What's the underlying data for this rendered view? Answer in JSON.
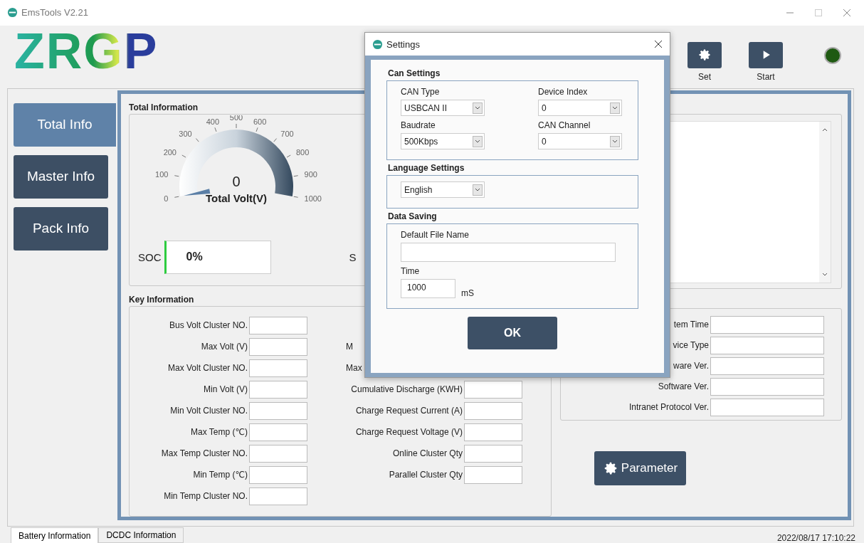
{
  "window": {
    "title": "EmsTools V2.21"
  },
  "logo": {
    "text": "ZRGP"
  },
  "toolbar": [
    {
      "label": "Set",
      "kind": "gear"
    },
    {
      "label": "Start",
      "kind": "play"
    }
  ],
  "status_light": {
    "lit": false
  },
  "nav": [
    {
      "label": "Total Info",
      "selected": true
    },
    {
      "label": "Master Info",
      "selected": false
    },
    {
      "label": "Pack Info",
      "selected": false
    }
  ],
  "total_information": {
    "title": "Total Information",
    "gauge": {
      "ticks": [
        "400",
        "500",
        "600",
        "300",
        "700",
        "200",
        "800",
        "100",
        "900",
        "0",
        "1000"
      ],
      "value": "0",
      "label": "Total Volt(V)",
      "level": 0
    },
    "soc": {
      "label": "SOC",
      "value": "0%"
    },
    "cut_label": "S"
  },
  "key_information": {
    "title": "Key Information",
    "left": [
      {
        "label": "Bus Volt Cluster NO.",
        "cut": false
      },
      {
        "label": "Max Volt (V)",
        "cut": false
      },
      {
        "label": "Max Volt Cluster NO.",
        "cut": false
      },
      {
        "label": "Min Volt (V)",
        "cut": false
      },
      {
        "label": "Min Volt Cluster NO.",
        "cut": false
      },
      {
        "label": "Max Temp (℃)",
        "cut": false
      },
      {
        "label": "Max Temp Cluster NO.",
        "cut": false
      },
      {
        "label": "Min Temp (℃)",
        "cut": false
      },
      {
        "label": "Min Temp Cluster NO.",
        "cut": false
      }
    ],
    "right": [
      {
        "label": "M",
        "cut": true
      },
      {
        "label": "Max",
        "cut": true
      },
      {
        "label": "Cumulative Discharge (KWH)",
        "cut": false
      },
      {
        "label": "Charge Request Current (A)",
        "cut": false
      },
      {
        "label": "Charge Request Voltage (V)",
        "cut": false
      },
      {
        "label": "Online Cluster Qty",
        "cut": false
      },
      {
        "label": "Parallel Cluster Qty",
        "cut": false
      }
    ]
  },
  "device_information": {
    "rows": [
      "tem Time",
      "vice Type",
      "ware Ver.",
      "Software Ver.",
      "Intranet Protocol Ver."
    ]
  },
  "parameter_button": {
    "label": "Parameter"
  },
  "bottom_tabs": [
    {
      "label": "Battery Information",
      "selected": true
    },
    {
      "label": "DCDC Information",
      "selected": false
    }
  ],
  "timestamp": "2022/08/17 17:10:22",
  "dialog": {
    "title": "Settings",
    "sections": [
      {
        "title": "Can Settings",
        "fields": [
          {
            "label": "CAN Type",
            "kind": "select",
            "value": "USBCAN II"
          },
          {
            "label": "Device Index",
            "kind": "select",
            "value": "0"
          },
          {
            "label": "Baudrate",
            "kind": "select",
            "value": "500Kbps"
          },
          {
            "label": "CAN Channel",
            "kind": "select",
            "value": "0"
          }
        ]
      },
      {
        "title": "Language Settings",
        "fields": [
          {
            "kind": "select",
            "value": "English"
          }
        ]
      },
      {
        "title": "Data Saving",
        "fields": [
          {
            "label": "Default File Name",
            "kind": "text"
          },
          {
            "label": "Time",
            "kind": "number",
            "value": "1000",
            "unit": "mS"
          }
        ]
      }
    ],
    "ok": "OK"
  }
}
